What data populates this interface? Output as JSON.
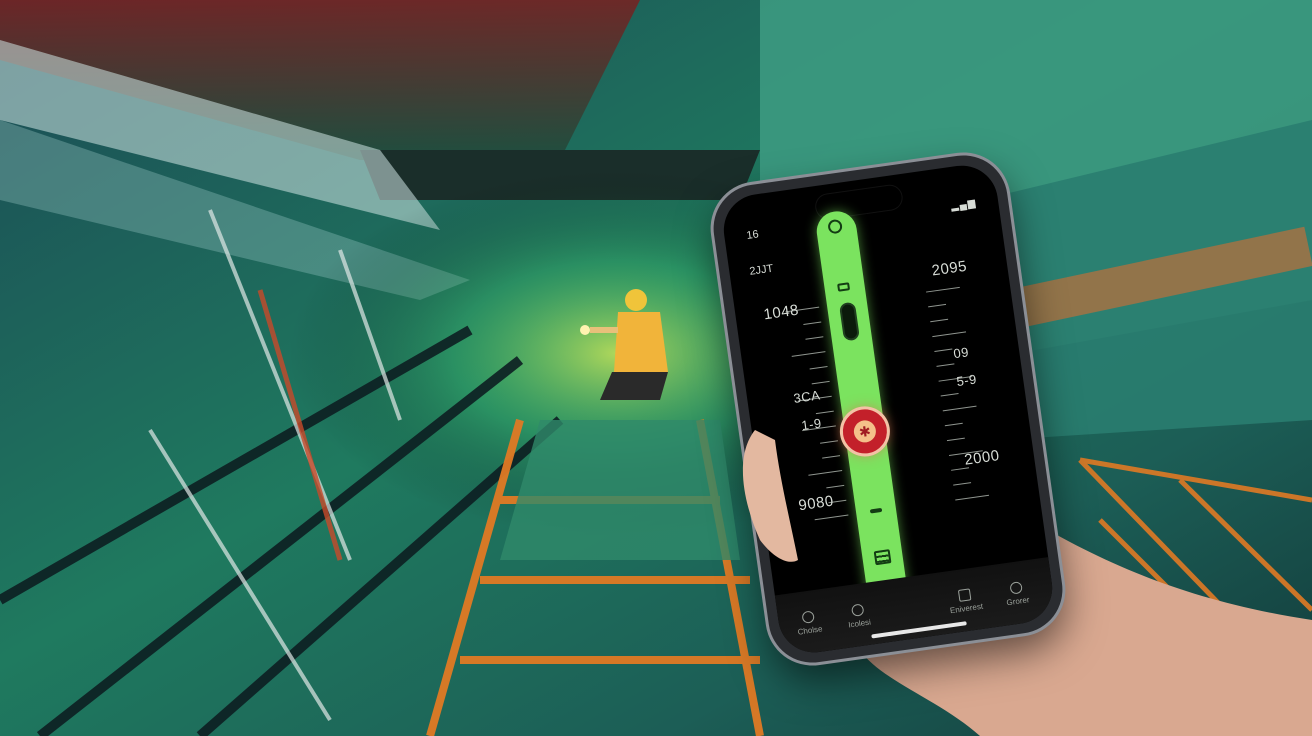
{
  "phone": {
    "status_left": "16",
    "status_right": "▂▄▆",
    "top_label": "2JJT",
    "readouts": {
      "top_left": "1048",
      "top_right": "2095",
      "mid_right": "09",
      "bubble_left_top": "3CA",
      "bubble_left_bottom": "1-9",
      "bubble_right": "5-9",
      "bottom_right": "2000",
      "bottom_left": "9080"
    },
    "bubble_glyph": "✱",
    "tabs": [
      {
        "label": "Cholse"
      },
      {
        "label": "Icolesi"
      },
      {
        "label": "Eniverest"
      },
      {
        "label": "Grorer"
      }
    ]
  },
  "colors": {
    "accent_green": "#7be35f",
    "bubble_red": "#c3202a",
    "scaffold_orange": "#e07a24",
    "teal_bg": "#1f6b63"
  },
  "icons": [
    "ring-icon",
    "slot-icon",
    "bubble-icon",
    "grid-icon",
    "home-icon",
    "worker",
    "scaffold"
  ]
}
